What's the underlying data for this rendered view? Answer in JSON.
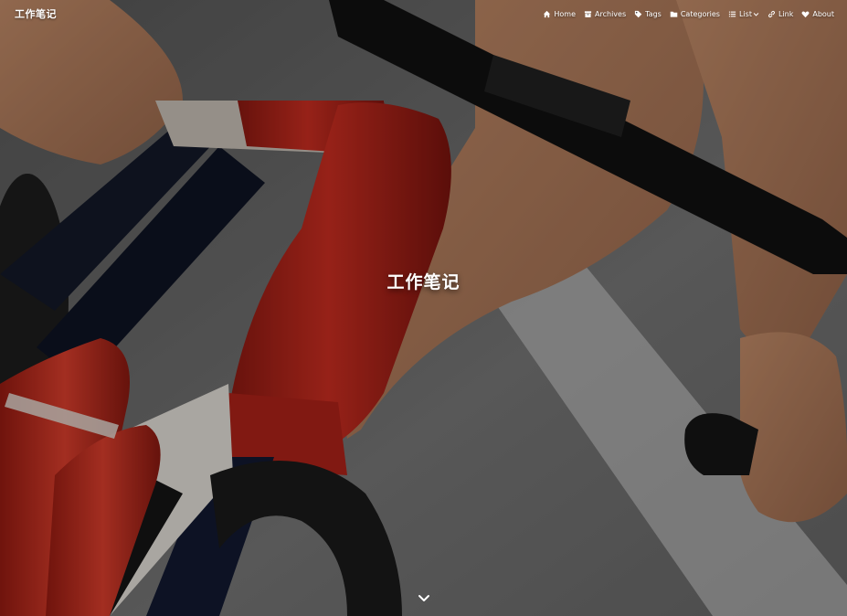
{
  "site": {
    "title": "工作笔记"
  },
  "nav": {
    "items": [
      {
        "label": "Home",
        "icon": "home-icon"
      },
      {
        "label": "Archives",
        "icon": "archive-icon"
      },
      {
        "label": "Tags",
        "icon": "tag-icon"
      },
      {
        "label": "Categories",
        "icon": "folder-icon"
      },
      {
        "label": "List",
        "icon": "list-icon"
      },
      {
        "label": "Link",
        "icon": "link-icon"
      },
      {
        "label": "About",
        "icon": "heart-icon"
      }
    ]
  },
  "hero": {
    "title": "工作笔记",
    "scroll_icon": "chevron-down-icon"
  },
  "colors": {
    "text": "#ffffff",
    "frame_red": "#c0271d",
    "frame_dark": "#141a2a",
    "skin": "#c98f6a",
    "road": "#6d6d6d"
  }
}
